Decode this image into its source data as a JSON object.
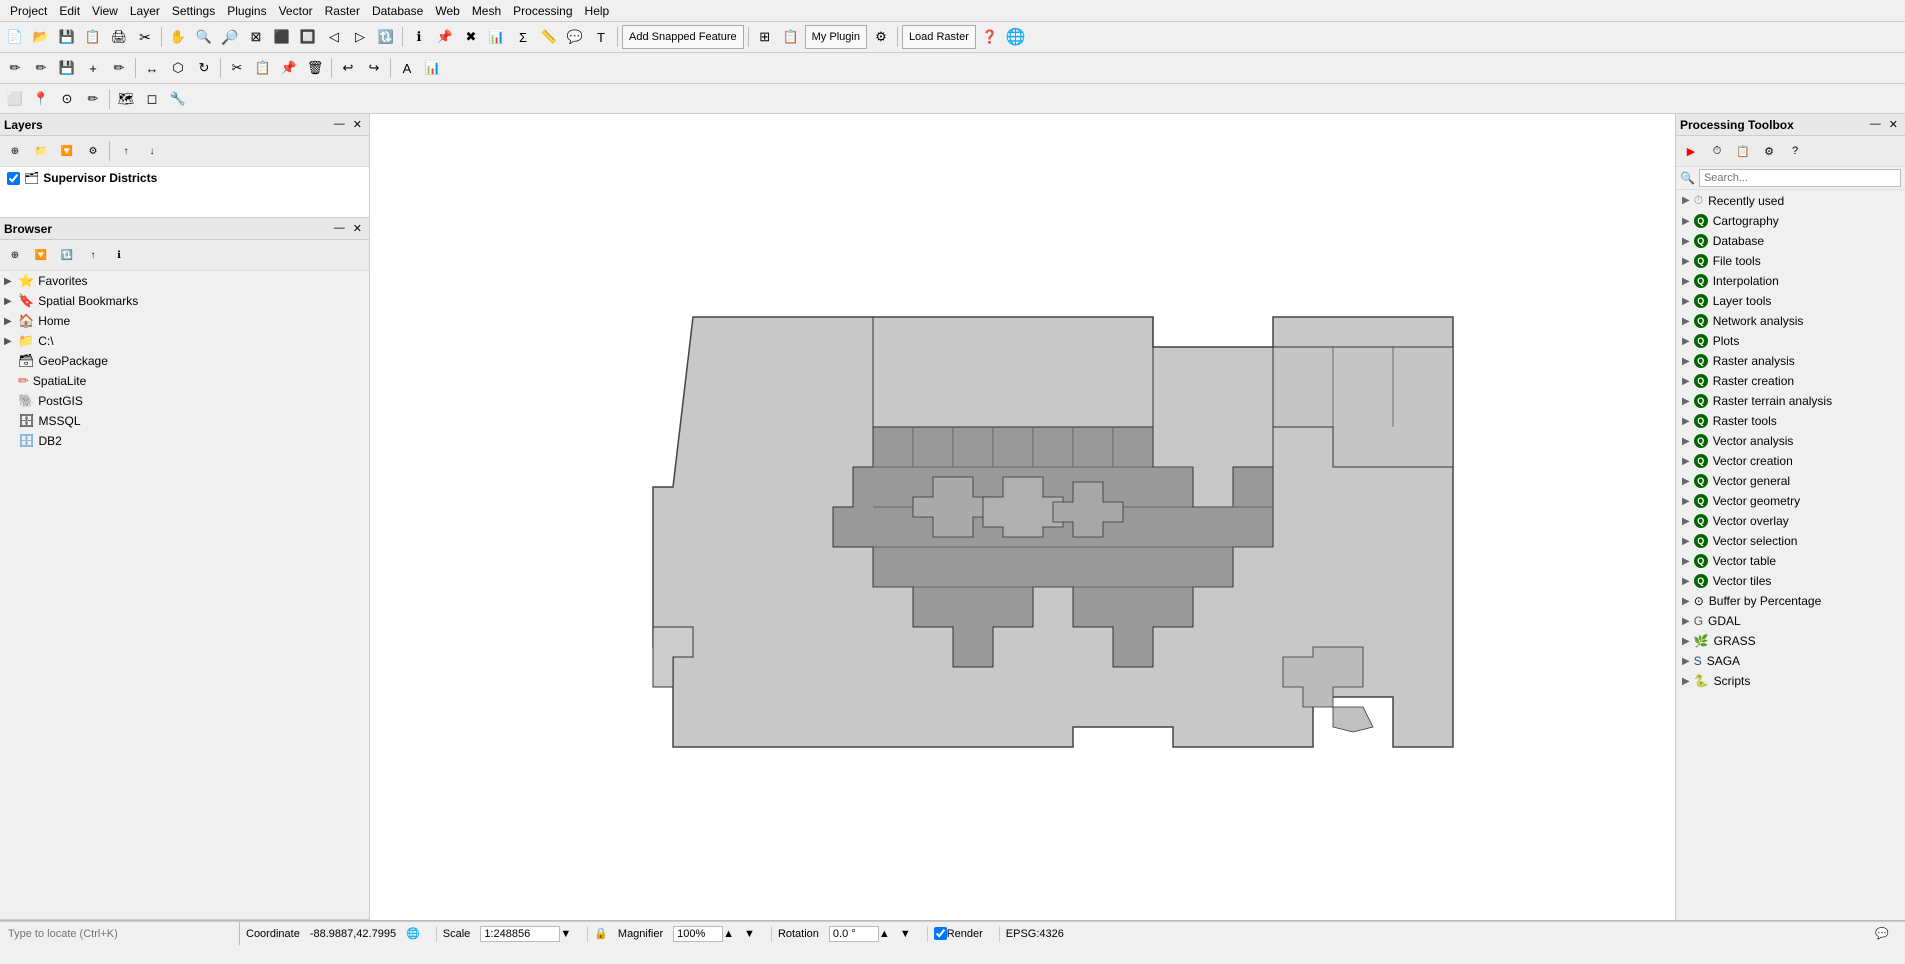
{
  "menubar": {
    "items": [
      "Project",
      "Edit",
      "View",
      "Layer",
      "Settings",
      "Plugins",
      "Vector",
      "Raster",
      "Database",
      "Web",
      "Mesh",
      "Processing",
      "Help"
    ]
  },
  "toolbar1": {
    "buttons": [
      "📂",
      "💾",
      "🖨",
      "✂",
      "📋",
      "↩",
      "↪",
      "🔍",
      "🔎",
      "⟲",
      "⟳",
      "📐",
      "📏",
      "✋",
      "🔍+",
      "🔍-",
      "⬜",
      "📌",
      "🗺",
      "📊",
      "🔄",
      "⌛",
      "🔃",
      "🔍",
      "📋",
      "📄",
      "⚙",
      "Σ",
      "📊",
      "💬",
      "T"
    ]
  },
  "layers_panel": {
    "title": "Layers",
    "toolbar_icons": [
      "⊕",
      "🗑",
      "🔽",
      "⚙",
      "↑",
      "↓"
    ],
    "items": [
      {
        "id": "supervisor-districts",
        "name": "Supervisor Districts",
        "checked": true,
        "icon": "🗂"
      }
    ]
  },
  "browser_panel": {
    "title": "Browser",
    "toolbar_icons": [
      "⊕",
      "🔽",
      "🔃",
      "↑",
      "ℹ"
    ],
    "items": [
      {
        "id": "favorites",
        "name": "Favorites",
        "icon": "⭐",
        "expandable": true
      },
      {
        "id": "spatial-bookmarks",
        "name": "Spatial Bookmarks",
        "icon": "🔖",
        "expandable": true
      },
      {
        "id": "home",
        "name": "Home",
        "icon": "🏠",
        "expandable": true
      },
      {
        "id": "c-drive",
        "name": "C:\\",
        "icon": "📁",
        "expandable": true
      },
      {
        "id": "geopackage",
        "name": "GeoPackage",
        "icon": "🗃",
        "expandable": false
      },
      {
        "id": "spatialite",
        "name": "SpatiaLite",
        "icon": "✏",
        "expandable": false
      },
      {
        "id": "postgis",
        "name": "PostGIS",
        "icon": "🐘",
        "expandable": false
      },
      {
        "id": "mssql",
        "name": "MSSQL",
        "icon": "🗄",
        "expandable": false
      },
      {
        "id": "db2",
        "name": "DB2",
        "icon": "🗄",
        "expandable": false
      }
    ]
  },
  "processing_toolbox": {
    "title": "Processing Toolbox",
    "search_placeholder": "Search...",
    "items": [
      {
        "id": "recently-used",
        "label": "Recently used",
        "icon": "clock",
        "expandable": true
      },
      {
        "id": "cartography",
        "label": "Cartography",
        "icon": "q",
        "expandable": true
      },
      {
        "id": "database",
        "label": "Database",
        "icon": "q",
        "expandable": true
      },
      {
        "id": "file-tools",
        "label": "File tools",
        "icon": "q",
        "expandable": true
      },
      {
        "id": "interpolation",
        "label": "Interpolation",
        "icon": "q",
        "expandable": true
      },
      {
        "id": "layer-tools",
        "label": "Layer tools",
        "icon": "q",
        "expandable": true
      },
      {
        "id": "network-analysis",
        "label": "Network analysis",
        "icon": "q",
        "expandable": true
      },
      {
        "id": "plots",
        "label": "Plots",
        "icon": "q",
        "expandable": true
      },
      {
        "id": "raster-analysis",
        "label": "Raster analysis",
        "icon": "q",
        "expandable": true
      },
      {
        "id": "raster-creation",
        "label": "Raster creation",
        "icon": "q",
        "expandable": true
      },
      {
        "id": "raster-terrain-analysis",
        "label": "Raster terrain analysis",
        "icon": "q",
        "expandable": true
      },
      {
        "id": "raster-tools",
        "label": "Raster tools",
        "icon": "q",
        "expandable": true
      },
      {
        "id": "vector-analysis",
        "label": "Vector analysis",
        "icon": "q",
        "expandable": true
      },
      {
        "id": "vector-creation",
        "label": "Vector creation",
        "icon": "q",
        "expandable": true
      },
      {
        "id": "vector-general",
        "label": "Vector general",
        "icon": "q",
        "expandable": true
      },
      {
        "id": "vector-geometry",
        "label": "Vector geometry",
        "icon": "q",
        "expandable": true
      },
      {
        "id": "vector-overlay",
        "label": "Vector overlay",
        "icon": "q",
        "expandable": true
      },
      {
        "id": "vector-selection",
        "label": "Vector selection",
        "icon": "q",
        "expandable": true
      },
      {
        "id": "vector-table",
        "label": "Vector table",
        "icon": "q",
        "expandable": true
      },
      {
        "id": "vector-tiles",
        "label": "Vector tiles",
        "icon": "q",
        "expandable": true
      },
      {
        "id": "buffer-by-percentage",
        "label": "Buffer by Percentage",
        "icon": "custom",
        "expandable": true
      },
      {
        "id": "gdal",
        "label": "GDAL",
        "icon": "gdal",
        "expandable": true
      },
      {
        "id": "grass",
        "label": "GRASS",
        "icon": "grass",
        "expandable": true
      },
      {
        "id": "saga",
        "label": "SAGA",
        "icon": "saga",
        "expandable": true
      },
      {
        "id": "scripts",
        "label": "Scripts",
        "icon": "scripts",
        "expandable": true
      }
    ]
  },
  "statusbar": {
    "coordinate_label": "Coordinate",
    "coordinate_value": "-88.9887,42.7995",
    "scale_label": "Scale",
    "scale_value": "1:248856",
    "magnifier_label": "Magnifier",
    "magnifier_value": "100%",
    "rotation_label": "Rotation",
    "rotation_value": "0.0 °",
    "render_label": "Render",
    "crs_label": "EPSG:4326"
  },
  "locate_bar": {
    "placeholder": "Type to locate (Ctrl+K)"
  },
  "toolbar_extra": {
    "add_snapped_feature": "Add Snapped Feature",
    "my_plugin": "My Plugin",
    "load_raster": "Load Raster"
  }
}
